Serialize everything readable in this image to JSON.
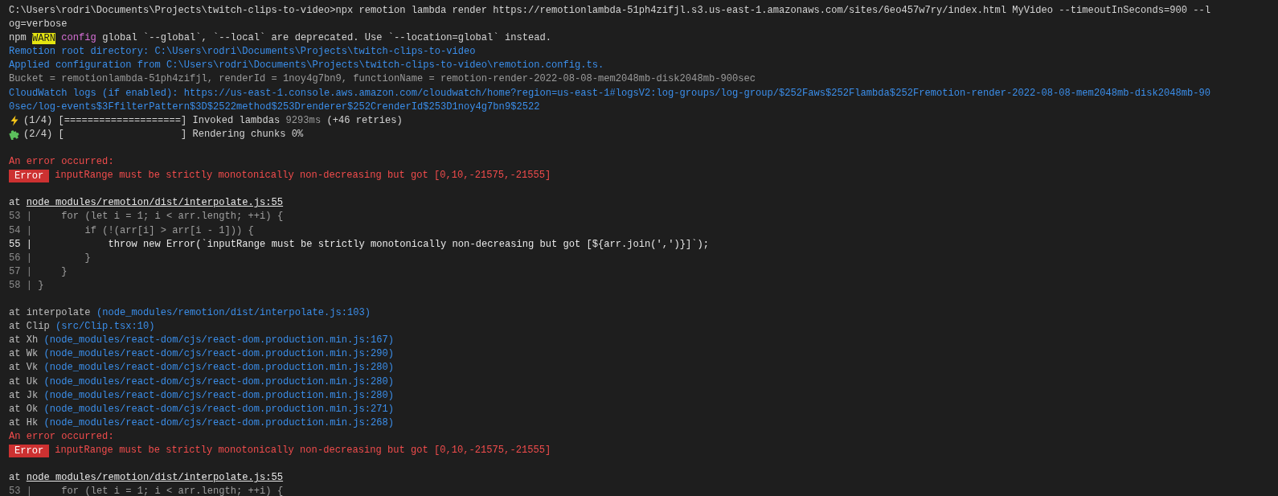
{
  "terminal": {
    "lines": [
      {
        "kind": "text",
        "segments": [
          {
            "kind": "plain",
            "text": "C:\\Users\\rodri\\Documents\\Projects\\twitch-clips-to-video>npx remotion lambda render https://remotionlambda-51ph4zifjl.s3.us-east-1.amazonaws.com/sites/6eo457w7ry/index.html MyVideo --timeoutInSeconds=900 --l"
          }
        ]
      },
      {
        "kind": "text",
        "segments": [
          {
            "kind": "plain",
            "text": "og=verbose"
          }
        ]
      },
      {
        "kind": "text",
        "segments": [
          {
            "kind": "plain",
            "text": "npm "
          },
          {
            "kind": "warn",
            "text": "WARN"
          },
          {
            "kind": "magenta",
            "text": " config"
          },
          {
            "kind": "plain",
            "text": " global `--global`, `--local` are deprecated. Use `--location=global` instead."
          }
        ]
      },
      {
        "kind": "text",
        "segments": [
          {
            "kind": "blue",
            "text": "Remotion root directory: C:\\Users\\rodri\\Documents\\Projects\\twitch-clips-to-video"
          }
        ]
      },
      {
        "kind": "text",
        "segments": [
          {
            "kind": "blue",
            "text": "Applied configuration from C:\\Users\\rodri\\Documents\\Projects\\twitch-clips-to-video\\remotion.config.ts."
          }
        ]
      },
      {
        "kind": "text",
        "segments": [
          {
            "kind": "dim",
            "text": "Bucket = remotionlambda-51ph4zifjl, renderId = 1noy4g7bn9, functionName = remotion-render-2022-08-08-mem2048mb-disk2048mb-900sec"
          }
        ]
      },
      {
        "kind": "text",
        "segments": [
          {
            "kind": "blue",
            "text": "CloudWatch logs (if enabled): https://us-east-1.console.aws.amazon.com/cloudwatch/home?region=us-east-1#logsV2:log-groups/log-group/$252Faws$252Flambda$252Fremotion-render-2022-08-08-mem2048mb-disk2048mb-90"
          }
        ]
      },
      {
        "kind": "text",
        "segments": [
          {
            "kind": "blue",
            "text": "0sec/log-events$3FfilterPattern$3D$2522method$253Drenderer$252CrenderId$253D1noy4g7bn9$2522"
          }
        ]
      },
      {
        "kind": "step",
        "segments": [
          {
            "kind": "plain",
            "text": "(1/4) [====================] Invoked lambdas "
          },
          {
            "kind": "dim",
            "text": "9293ms"
          },
          {
            "kind": "plain",
            "text": " (+46 retries)"
          }
        ]
      },
      {
        "kind": "step",
        "segments": [
          {
            "kind": "plain",
            "text": "(2/4) [                    ] Rendering chunks 0%"
          }
        ]
      },
      {
        "kind": "blank"
      },
      {
        "kind": "text",
        "segments": [
          {
            "kind": "red",
            "text": "An error occurred:"
          }
        ]
      },
      {
        "kind": "text",
        "segments": [
          {
            "kind": "badge",
            "text": "Error"
          },
          {
            "kind": "red",
            "text": "inputRange must be strictly monotonically non-decreasing but got [0,10,-21575,-21555]"
          }
        ]
      },
      {
        "kind": "blank"
      },
      {
        "kind": "text",
        "segments": [
          {
            "kind": "plain",
            "text": "at "
          },
          {
            "kind": "link",
            "text": "node_modules/remotion/dist/interpolate.js:55"
          }
        ]
      },
      {
        "kind": "code",
        "gutter": "53 |",
        "code": "    for (let i = 1; i < arr.length; ++i) {",
        "current": false
      },
      {
        "kind": "code",
        "gutter": "54 |",
        "code": "        if (!(arr[i] > arr[i - 1])) {",
        "current": false
      },
      {
        "kind": "code",
        "gutter": "55 |",
        "code": "            throw new Error(`inputRange must be strictly monotonically non-decreasing but got [${arr.join(',')}]`);",
        "current": true
      },
      {
        "kind": "code",
        "gutter": "56 |",
        "code": "        }",
        "current": false
      },
      {
        "kind": "code",
        "gutter": "57 |",
        "code": "    }",
        "current": false
      },
      {
        "kind": "code",
        "gutter": "58 |",
        "code": "}",
        "current": false
      },
      {
        "kind": "blank"
      },
      {
        "kind": "text",
        "segments": [
          {
            "kind": "frame",
            "text": "at interpolate "
          },
          {
            "kind": "blue",
            "text": "(node_modules/remotion/dist/interpolate.js:103)"
          }
        ]
      },
      {
        "kind": "text",
        "segments": [
          {
            "kind": "frame",
            "text": "at Clip "
          },
          {
            "kind": "blue",
            "text": "(src/Clip.tsx:10)"
          }
        ]
      },
      {
        "kind": "text",
        "segments": [
          {
            "kind": "frame",
            "text": "at Xh "
          },
          {
            "kind": "blue",
            "text": "(node_modules/react-dom/cjs/react-dom.production.min.js:167)"
          }
        ]
      },
      {
        "kind": "text",
        "segments": [
          {
            "kind": "frame",
            "text": "at Wk "
          },
          {
            "kind": "blue",
            "text": "(node_modules/react-dom/cjs/react-dom.production.min.js:290)"
          }
        ]
      },
      {
        "kind": "text",
        "segments": [
          {
            "kind": "frame",
            "text": "at Vk "
          },
          {
            "kind": "blue",
            "text": "(node_modules/react-dom/cjs/react-dom.production.min.js:280)"
          }
        ]
      },
      {
        "kind": "text",
        "segments": [
          {
            "kind": "frame",
            "text": "at Uk "
          },
          {
            "kind": "blue",
            "text": "(node_modules/react-dom/cjs/react-dom.production.min.js:280)"
          }
        ]
      },
      {
        "kind": "text",
        "segments": [
          {
            "kind": "frame",
            "text": "at Jk "
          },
          {
            "kind": "blue",
            "text": "(node_modules/react-dom/cjs/react-dom.production.min.js:280)"
          }
        ]
      },
      {
        "kind": "text",
        "segments": [
          {
            "kind": "frame",
            "text": "at Ok "
          },
          {
            "kind": "blue",
            "text": "(node_modules/react-dom/cjs/react-dom.production.min.js:271)"
          }
        ]
      },
      {
        "kind": "text",
        "segments": [
          {
            "kind": "frame",
            "text": "at Hk "
          },
          {
            "kind": "blue",
            "text": "(node_modules/react-dom/cjs/react-dom.production.min.js:268)"
          }
        ]
      },
      {
        "kind": "text",
        "segments": [
          {
            "kind": "red",
            "text": "An error occurred:"
          }
        ]
      },
      {
        "kind": "text",
        "segments": [
          {
            "kind": "badge",
            "text": "Error"
          },
          {
            "kind": "red",
            "text": "inputRange must be strictly monotonically non-decreasing but got [0,10,-21575,-21555]"
          }
        ]
      },
      {
        "kind": "blank"
      },
      {
        "kind": "text",
        "segments": [
          {
            "kind": "plain",
            "text": "at "
          },
          {
            "kind": "link",
            "text": "node_modules/remotion/dist/interpolate.js:55"
          }
        ]
      },
      {
        "kind": "code",
        "gutter": "53 |",
        "code": "    for (let i = 1; i < arr.length; ++i) {",
        "current": false
      }
    ]
  }
}
